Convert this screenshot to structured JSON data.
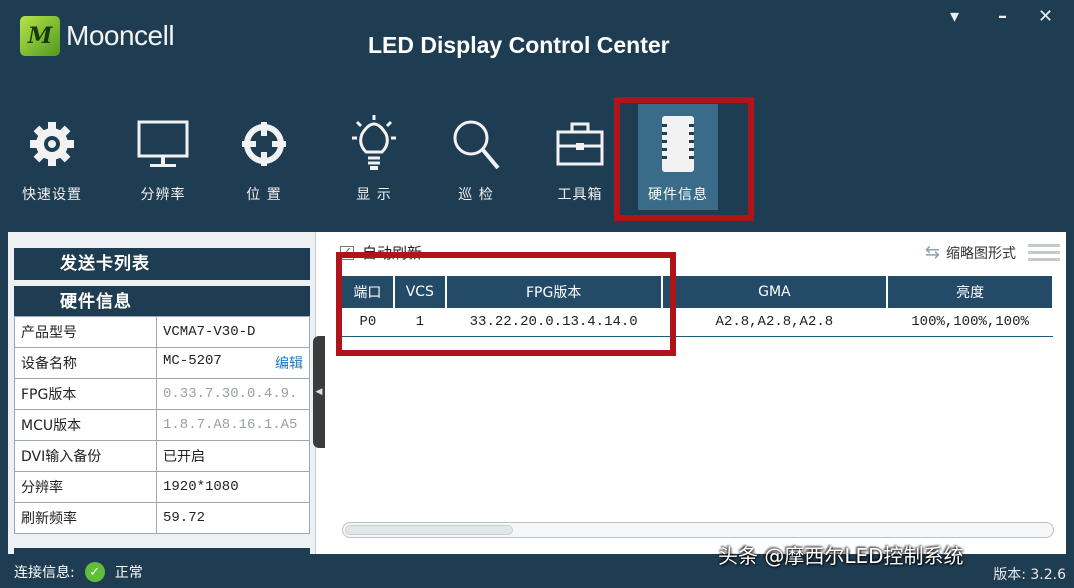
{
  "app": {
    "logo_text": "Mooncell",
    "title": "LED Display Control Center"
  },
  "window_controls": {
    "menu": "▾",
    "minimize": "–",
    "close": "✕"
  },
  "toolbar": [
    {
      "label": "快速设置",
      "icon": "gear-icon"
    },
    {
      "label": "分辨率",
      "icon": "monitor-icon"
    },
    {
      "label": "位 置",
      "icon": "crosshair-icon"
    },
    {
      "label": "显 示",
      "icon": "light-bulb-icon"
    },
    {
      "label": "巡 检",
      "icon": "magnifier-icon"
    },
    {
      "label": "工具箱",
      "icon": "toolbox-icon"
    },
    {
      "label": "硬件信息",
      "icon": "chip-icon",
      "active": true
    }
  ],
  "sidebar": {
    "send_card_list_label": "发送卡列表",
    "hardware_info_label": "硬件信息",
    "properties": [
      {
        "key": "产品型号",
        "value": "VCMA7-V30-D"
      },
      {
        "key": "设备名称",
        "value": "MC-5207",
        "action": "编辑"
      },
      {
        "key": "FPG版本",
        "value": "0.33.7.30.0.4.9."
      },
      {
        "key": "MCU版本",
        "value": "1.8.7.A8.16.1.A5"
      },
      {
        "key": "DVI输入备份",
        "value": "已开启"
      },
      {
        "key": "分辨率",
        "value": "1920*1080"
      },
      {
        "key": "刷新频率",
        "value": "59.72"
      }
    ]
  },
  "main": {
    "auto_refresh_label": "自动刷新",
    "auto_refresh_checked": true,
    "thumbnail_mode_label": "缩略图形式",
    "table": {
      "headers": [
        "端口",
        "VCS",
        "FPG版本",
        "GMA",
        "亮度"
      ],
      "rows": [
        [
          "P0",
          "1",
          "33.22.20.0.13.4.14.0",
          "A2.8,A2.8,A2.8",
          "100%,100%,100%"
        ]
      ]
    }
  },
  "status": {
    "connection_label": "连接信息:",
    "connection_value": "正常",
    "version_text": "版本: 3.2.6"
  },
  "watermark": "头条 @摩西尔LED控制系统",
  "colors": {
    "background": "#1f3d52",
    "table_header": "#234a66",
    "highlight_box": "#b0141b",
    "link": "#1a78c8",
    "ok": "#5fbf3a"
  }
}
